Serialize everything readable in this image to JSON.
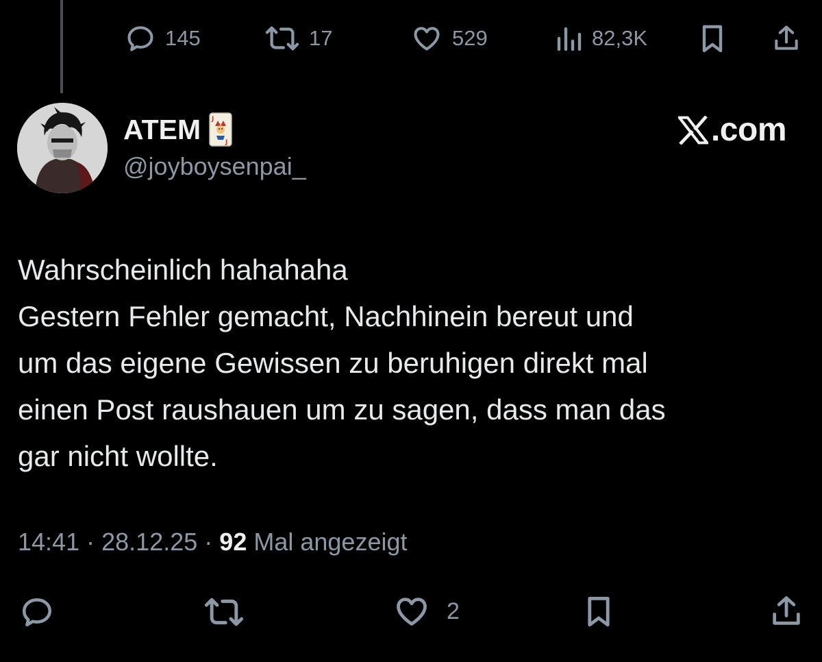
{
  "parent_tweet": {
    "stats": {
      "replies": "145",
      "reposts": "17",
      "likes": "529",
      "views": "82,3K"
    }
  },
  "tweet": {
    "display_name": "ATEM",
    "handle": "@joyboysenpai_",
    "brand": ".com",
    "body_lines": [
      "Wahrscheinlich hahahaha",
      "Gestern Fehler gemacht, Nachhinein bereut und",
      "um das eigene Gewissen zu beruhigen direkt mal",
      "einen Post raushauen um zu sagen, dass man das",
      "gar nicht wollte."
    ],
    "time": "14:41",
    "date": "28.12.25",
    "views_count": "92",
    "views_label": "Mal angezeigt",
    "separator": "·",
    "likes": "2"
  },
  "icons": {
    "reply": "reply-icon",
    "repost": "repost-icon",
    "like": "heart-icon",
    "views": "analytics-icon",
    "bookmark": "bookmark-icon",
    "share": "share-icon",
    "emoji": "joker-card-emoji",
    "brand_logo": "x-logo-icon"
  },
  "colors": {
    "background": "#000000",
    "text": "#e7e9ea",
    "muted": "#8b98a5"
  }
}
